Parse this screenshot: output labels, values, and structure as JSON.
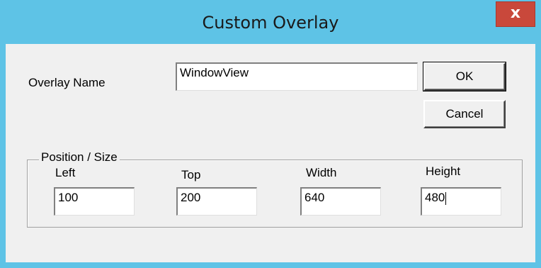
{
  "window": {
    "title": "Custom Overlay",
    "close_label": "x"
  },
  "form": {
    "overlay_name_label": "Overlay Name",
    "overlay_name_value": "WindowView",
    "ok_label": "OK",
    "cancel_label": "Cancel"
  },
  "group": {
    "title": "Position / Size",
    "fields": [
      {
        "label": "Left",
        "value": "100"
      },
      {
        "label": "Top",
        "value": "200"
      },
      {
        "label": "Width",
        "value": "640"
      },
      {
        "label": "Height",
        "value": "480"
      }
    ]
  },
  "colors": {
    "titlebar": "#5ec3e6",
    "close": "#c9483b",
    "client": "#f0f0f0"
  }
}
